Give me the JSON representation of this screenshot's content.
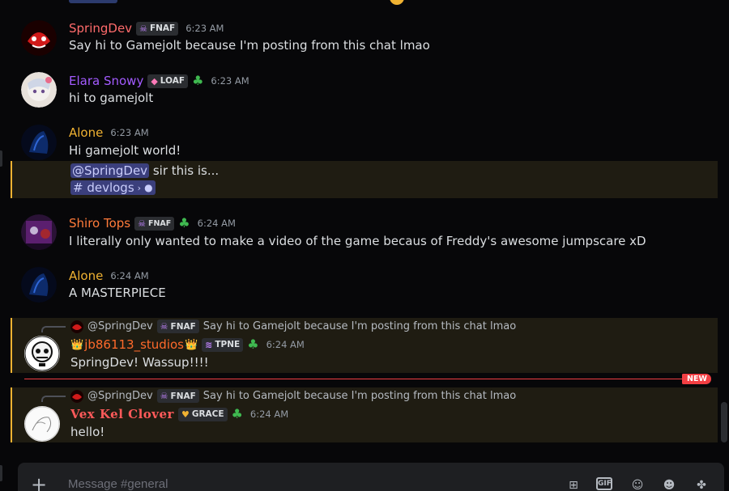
{
  "composer": {
    "placeholder": "Message #general"
  },
  "colors": {
    "new_divider": "#f23f43",
    "accent_mention": "#3b3f7c",
    "highlight_bg": "#1f1c12",
    "highlight_border": "#f0b232"
  },
  "divider": {
    "label": "NEW"
  },
  "messages": [
    {
      "author": "SpringDev",
      "author_color": "#ff6b6b",
      "tag": {
        "icon": "skull-icon",
        "label": "FNAF"
      },
      "time": "6:23 AM",
      "text": "Say hi to Gamejolt because I'm posting from this chat lmao"
    },
    {
      "author": "Elara Snowy",
      "author_color": "#a35bff",
      "tag": {
        "icon": "diamond-icon",
        "label": "LOAF"
      },
      "clover": true,
      "time": "6:23 AM",
      "text": "hi to gamejolt"
    },
    {
      "author": "Alone",
      "author_color": "#f0b232",
      "time": "6:23 AM",
      "text": "Hi gamejolt world!",
      "followup": {
        "mention": "@SpringDev",
        "text": " sir this is...",
        "channel": "# devlogs",
        "channel_suffix": "›"
      }
    },
    {
      "author": "Shiro Tops",
      "author_color": "#ff7b3a",
      "tag": {
        "icon": "skull-icon",
        "label": "FNAF"
      },
      "clover": true,
      "time": "6:24 AM",
      "text": "I literally only wanted to make a video of the game becaus of Freddy's awesome jumpscare xD"
    },
    {
      "author": "Alone",
      "author_color": "#f0b232",
      "time": "6:24 AM",
      "text": "A MASTERPIECE"
    },
    {
      "reply": {
        "author": "@SpringDev",
        "tag": "FNAF",
        "text": "Say hi to Gamejolt because I'm posting from this chat lmao"
      },
      "author": "jb86113_studios",
      "author_color": "#ff6a2b",
      "crown": "👑",
      "tag": {
        "icon": "stack-icon",
        "label": "TPNE"
      },
      "clover": true,
      "time": "6:24 AM",
      "text": "SpringDev! Wassup!!!!"
    },
    {
      "reply": {
        "author": "@SpringDev",
        "tag": "FNAF",
        "text": "Say hi to Gamejolt because I'm posting from this chat lmao"
      },
      "author": "Vex Kel Clover",
      "author_color": "#ff5a5a",
      "tag": {
        "icon": "heart-icon",
        "label": "GRACE"
      },
      "clover": true,
      "time": "6:24 AM",
      "text": "hello!"
    }
  ]
}
